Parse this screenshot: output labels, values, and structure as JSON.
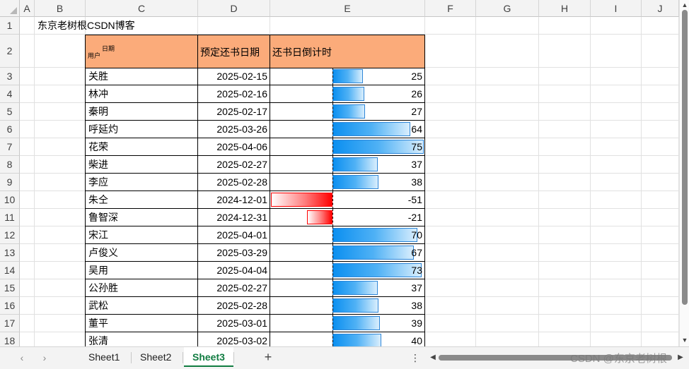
{
  "columns": [
    "A",
    "B",
    "C",
    "D",
    "E",
    "F",
    "G",
    "H",
    "I",
    "J"
  ],
  "row_numbers": [
    "1",
    "2",
    "3",
    "4",
    "5",
    "6",
    "7",
    "8",
    "9",
    "10",
    "11",
    "12",
    "13",
    "14",
    "15",
    "16",
    "17",
    "18"
  ],
  "title": "东京老树根CSDN博客",
  "header": {
    "user_label": "用户",
    "date_label": "日期",
    "due_date": "预定还书日期",
    "countdown": "还书日倒计时"
  },
  "rows": [
    {
      "name": "关胜",
      "date": "2025-02-15",
      "days": 25
    },
    {
      "name": "林冲",
      "date": "2025-02-16",
      "days": 26
    },
    {
      "name": "秦明",
      "date": "2025-02-17",
      "days": 27
    },
    {
      "name": "呼延灼",
      "date": "2025-03-26",
      "days": 64
    },
    {
      "name": "花荣",
      "date": "2025-04-06",
      "days": 75
    },
    {
      "name": "柴进",
      "date": "2025-02-27",
      "days": 37
    },
    {
      "name": "李应",
      "date": "2025-02-28",
      "days": 38
    },
    {
      "name": "朱仝",
      "date": "2024-12-01",
      "days": -51
    },
    {
      "name": "鲁智深",
      "date": "2024-12-31",
      "days": -21
    },
    {
      "name": "宋江",
      "date": "2025-04-01",
      "days": 70
    },
    {
      "name": "卢俊义",
      "date": "2025-03-29",
      "days": 67
    },
    {
      "name": "吴用",
      "date": "2025-04-04",
      "days": 73
    },
    {
      "name": "公孙胜",
      "date": "2025-02-27",
      "days": 37
    },
    {
      "name": "武松",
      "date": "2025-02-28",
      "days": 38
    },
    {
      "name": "董平",
      "date": "2025-03-01",
      "days": 39
    },
    {
      "name": "张清",
      "date": "2025-03-02",
      "days": 40
    }
  ],
  "databar": {
    "axis_min": -51,
    "axis_max": 75,
    "positive_color": "#0b8ff0",
    "negative_color": "#ff0000"
  },
  "colors": {
    "header_fill": "#fbab7a",
    "active_tab": "#107c41"
  },
  "tabs": [
    {
      "label": "Sheet1",
      "active": false
    },
    {
      "label": "Sheet2",
      "active": false
    },
    {
      "label": "Sheet3",
      "active": true
    }
  ],
  "icons": {
    "nav_prev": "chevron-left-icon",
    "nav_next": "chevron-right-icon",
    "add_sheet": "plus-icon",
    "more": "vertical-dots-icon"
  },
  "watermark": "CSDN @东京老树根"
}
